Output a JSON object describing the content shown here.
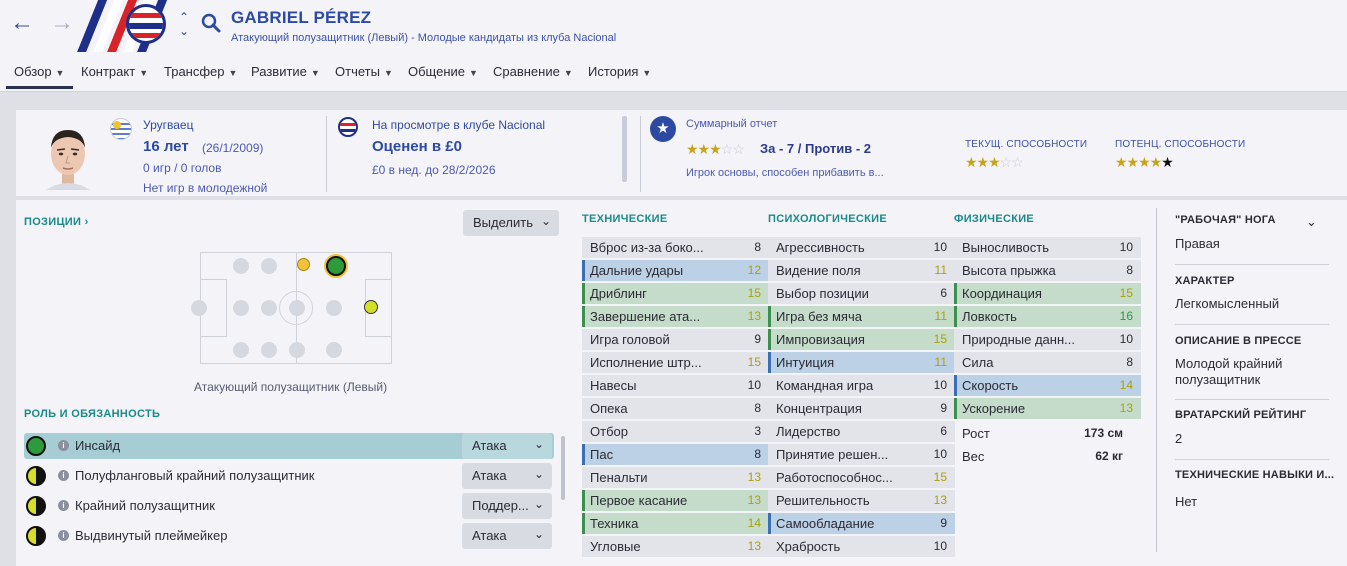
{
  "header": {
    "player_name": "GABRIEL PÉREZ",
    "subtitle": "Атакующий полузащитник (Левый) - Молодые кандидаты из клуба Nacional"
  },
  "tabs": [
    {
      "label": "Обзор"
    },
    {
      "label": "Контракт"
    },
    {
      "label": "Трансфер"
    },
    {
      "label": "Развитие"
    },
    {
      "label": "Отчеты"
    },
    {
      "label": "Общение"
    },
    {
      "label": "Сравнение"
    },
    {
      "label": "История"
    }
  ],
  "summary": {
    "nationality": "Уругваец",
    "age": "16 лет",
    "dob": "(26/1/2009)",
    "games": "0 игр / 0 голов",
    "youth_games": "Нет игр в молодежной",
    "trial_status": "На просмотре в клубе Nacional",
    "valuation": "Оценен в £0",
    "wage": "£0 в нед. до 28/2/2026",
    "report_label": "Суммарный отчет",
    "report_stars": 3,
    "report_votes": "За - 7 / Против - 2",
    "report_desc": "Игрок основы, способен прибавить в...",
    "current_ability_label": "ТЕКУЩ. СПОСОБНОСТИ",
    "current_ability_stars": 3,
    "potential_ability_label": "ПОТЕНЦ. СПОСОБНОСТИ",
    "potential_ability_stars": 5
  },
  "positions": {
    "title": "ПОЗИЦИИ",
    "highlight_label": "Выделить",
    "caption": "Атакующий полузащитник (Левый)"
  },
  "roles": {
    "title": "РОЛЬ И ОБЯЗАННОСТЬ",
    "items": [
      {
        "name": "Инсайд",
        "duty": "Атака"
      },
      {
        "name": "Полуфланговый крайний полузащитник",
        "duty": "Атака"
      },
      {
        "name": "Крайний полузащитник",
        "duty": "Поддер..."
      },
      {
        "name": "Выдвинутый плеймейкер",
        "duty": "Атака"
      }
    ]
  },
  "attributes": {
    "technical_title": "ТЕХНИЧЕСКИЕ",
    "mental_title": "ПСИХОЛОГИЧЕСКИЕ",
    "physical_title": "ФИЗИЧЕСКИЕ",
    "technical": [
      {
        "name": "Вброс из-за боко...",
        "value": "8",
        "hl": "n"
      },
      {
        "name": "Дальние удары",
        "value": "12",
        "hl": "b"
      },
      {
        "name": "Дриблинг",
        "value": "15",
        "hl": "g"
      },
      {
        "name": "Завершение ата...",
        "value": "13",
        "hl": "g"
      },
      {
        "name": "Игра головой",
        "value": "9",
        "hl": "n"
      },
      {
        "name": "Исполнение штр...",
        "value": "15",
        "hl": "n"
      },
      {
        "name": "Навесы",
        "value": "10",
        "hl": "n"
      },
      {
        "name": "Опека",
        "value": "8",
        "hl": "n"
      },
      {
        "name": "Отбор",
        "value": "3",
        "hl": "n"
      },
      {
        "name": "Пас",
        "value": "8",
        "hl": "b"
      },
      {
        "name": "Пенальти",
        "value": "13",
        "hl": "n"
      },
      {
        "name": "Первое касание",
        "value": "13",
        "hl": "g"
      },
      {
        "name": "Техника",
        "value": "14",
        "hl": "g"
      },
      {
        "name": "Угловые",
        "value": "13",
        "hl": "n"
      }
    ],
    "mental": [
      {
        "name": "Агрессивность",
        "value": "10",
        "hl": "n"
      },
      {
        "name": "Видение поля",
        "value": "11",
        "hl": "n"
      },
      {
        "name": "Выбор позиции",
        "value": "6",
        "hl": "n"
      },
      {
        "name": "Игра без мяча",
        "value": "11",
        "hl": "g"
      },
      {
        "name": "Импровизация",
        "value": "15",
        "hl": "g"
      },
      {
        "name": "Интуиция",
        "value": "11",
        "hl": "b"
      },
      {
        "name": "Командная игра",
        "value": "10",
        "hl": "n"
      },
      {
        "name": "Концентрация",
        "value": "9",
        "hl": "n"
      },
      {
        "name": "Лидерство",
        "value": "6",
        "hl": "n"
      },
      {
        "name": "Принятие решен...",
        "value": "10",
        "hl": "n"
      },
      {
        "name": "Работоспособнос...",
        "value": "15",
        "hl": "n"
      },
      {
        "name": "Решительность",
        "value": "13",
        "hl": "n"
      },
      {
        "name": "Самообладание",
        "value": "9",
        "hl": "b"
      },
      {
        "name": "Храбрость",
        "value": "10",
        "hl": "n"
      }
    ],
    "physical": [
      {
        "name": "Выносливость",
        "value": "10",
        "hl": "n"
      },
      {
        "name": "Высота прыжка",
        "value": "8",
        "hl": "n"
      },
      {
        "name": "Координация",
        "value": "15",
        "hl": "g"
      },
      {
        "name": "Ловкость",
        "value": "16",
        "hl": "g"
      },
      {
        "name": "Природные данн...",
        "value": "10",
        "hl": "n"
      },
      {
        "name": "Сила",
        "value": "8",
        "hl": "n"
      },
      {
        "name": "Скорость",
        "value": "14",
        "hl": "b"
      },
      {
        "name": "Ускорение",
        "value": "13",
        "hl": "g"
      },
      {
        "name": "Рост",
        "value": "173 см",
        "hl": "none"
      },
      {
        "name": "Вес",
        "value": "62 кг",
        "hl": "none"
      }
    ]
  },
  "info": {
    "foot_title": "\"РАБОЧАЯ\" НОГА",
    "foot_value": "Правая",
    "character_title": "ХАРАКТЕР",
    "character_value": "Легкомысленный",
    "press_title": "ОПИСАНИЕ В ПРЕССЕ",
    "press_value": "Молодой крайний полузащитник",
    "gk_title": "ВРАТАРСКИЙ РЕЙТИНГ",
    "gk_value": "2",
    "tech_skills_title": "ТЕХНИЧЕСКИЕ НАВЫКИ И...",
    "tech_skills_value": "Нет"
  },
  "colors": {
    "accent": "#2c4aa2",
    "section_teal": "#1a8a8a",
    "value_low": "#2b2b35",
    "value_mid": "#a9a010",
    "value_high": "#2f9a3c"
  }
}
